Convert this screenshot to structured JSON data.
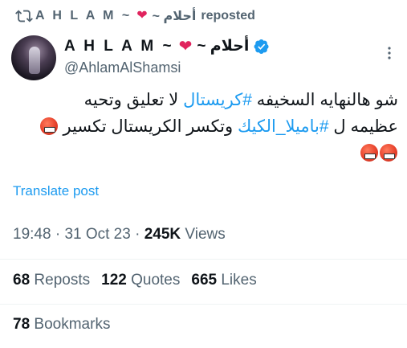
{
  "repost_header": {
    "name_latin": "A H L A M ~",
    "name_arabic": "~ أحلام",
    "suffix": "reposted"
  },
  "author": {
    "name_latin": "A H L A M ~",
    "name_arabic": "~ أحلام",
    "handle": "@AhlamAlShamsi",
    "verified": true
  },
  "tweet": {
    "line1_pre": "شو هالنهايه  السخيفه ",
    "line1_tag": "#كريستال",
    "line1_post": " لا تعليق وتحيه",
    "line2_pre": "عظيمه ل ",
    "line2_tag": "#باميلا_الكيك",
    "line2_post": " وتكسر الكريستال تكسير"
  },
  "translate_label": "Translate post",
  "meta": {
    "time": "19:48",
    "date": "31 Oct 23",
    "views_count": "245K",
    "views_label": "Views"
  },
  "stats": {
    "reposts_count": "68",
    "reposts_label": "Reposts",
    "quotes_count": "122",
    "quotes_label": "Quotes",
    "likes_count": "665",
    "likes_label": "Likes"
  },
  "bookmarks": {
    "count": "78",
    "label": "Bookmarks"
  },
  "colors": {
    "accent": "#1d9bf0",
    "heart": "#e0245e",
    "secondary_text": "#536471"
  },
  "icons": [
    "repost-icon",
    "heart-icon",
    "verified-badge-icon",
    "more-options-icon",
    "angry-emoji-icon"
  ]
}
